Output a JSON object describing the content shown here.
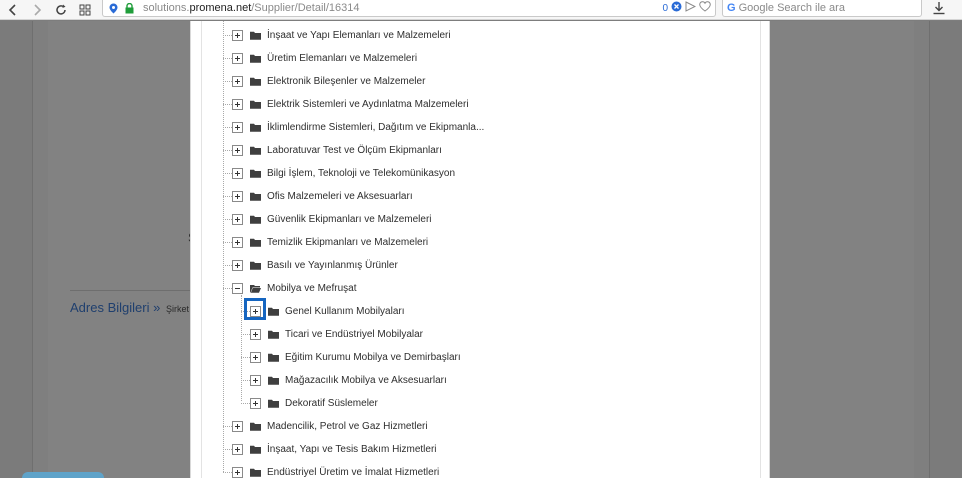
{
  "browser": {
    "url_prefix": "solutions.",
    "url_domain": "promena.net",
    "url_path": "/Supplier/Detail/16314",
    "url_badge_count": "0",
    "search_placeholder": "Google Search ile ara",
    "search_engine_letter": "G"
  },
  "background": {
    "letter": "S",
    "section_title": "Adres Bilgileri",
    "section_sep": "»",
    "section_sub": "Şirket ad"
  },
  "tree": {
    "top_items": [
      {
        "label": "İnşaat ve Yapı Elemanları ve Malzemeleri"
      },
      {
        "label": "Üretim Elemanları ve Malzemeleri"
      },
      {
        "label": "Elektronik Bileşenler ve Malzemeler"
      },
      {
        "label": "Elektrik Sistemleri ve Aydınlatma Malzemeleri"
      },
      {
        "label": "İklimlendirme Sistemleri, Dağıtım ve Ekipmanla..."
      },
      {
        "label": "Laboratuvar Test ve Ölçüm Ekipmanları"
      },
      {
        "label": "Bilgi İşlem, Teknoloji ve Telekomünikasyon"
      },
      {
        "label": "Ofis Malzemeleri ve Aksesuarları"
      },
      {
        "label": "Güvenlik Ekipmanları ve Malzemeleri"
      },
      {
        "label": "Temizlik Ekipmanları ve Malzemeleri"
      },
      {
        "label": "Basılı ve Yayınlanmış Ürünler"
      }
    ],
    "expanded_item": {
      "label": "Mobilya ve Mefruşat",
      "children": [
        {
          "label": "Genel Kullanım Mobilyaları"
        },
        {
          "label": "Ticari ve Endüstriyel Mobilyalar"
        },
        {
          "label": "Eğitim Kurumu Mobilya ve Demirbaşları"
        },
        {
          "label": "Mağazacılık Mobilya ve Aksesuarları"
        },
        {
          "label": "Dekoratif Süslemeler"
        }
      ]
    },
    "bottom_items": [
      {
        "label": "Madencilik, Petrol ve Gaz Hizmetleri"
      },
      {
        "label": "İnşaat, Yapı ve Tesis Bakım Hizmetleri"
      },
      {
        "label": "Endüstriyel Üretim ve İmalat Hizmetleri"
      }
    ]
  },
  "colors": {
    "highlight": "#1565c0",
    "folder": "#3f3f3f"
  }
}
